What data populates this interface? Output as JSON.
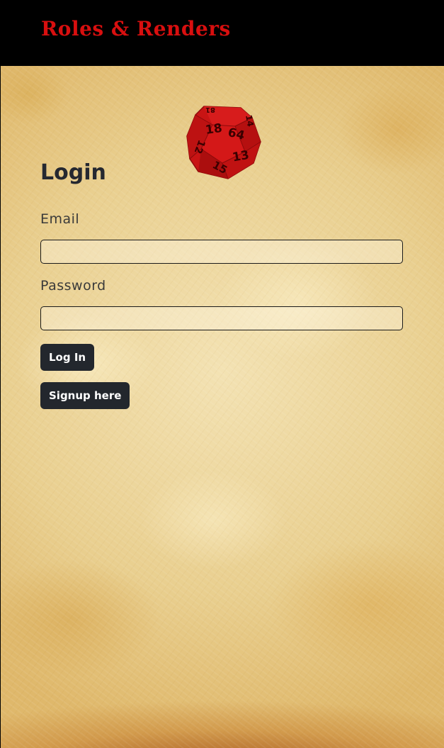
{
  "navbar": {
    "brand": "Roles & Renders"
  },
  "login": {
    "heading": "Login",
    "email_label": "Email",
    "email_value": "",
    "password_label": "Password",
    "password_value": "",
    "login_button": "Log In",
    "signup_button": "Signup here"
  },
  "die": {
    "icon": "d20-die-icon",
    "faces": [
      "18",
      "64",
      "12",
      "13",
      "15",
      "14",
      "81"
    ]
  },
  "colors": {
    "navbar_bg": "#000000",
    "brand": "#d80f0f",
    "heading": "#252830",
    "button_bg": "#23272d",
    "die_red": "#c81414"
  }
}
